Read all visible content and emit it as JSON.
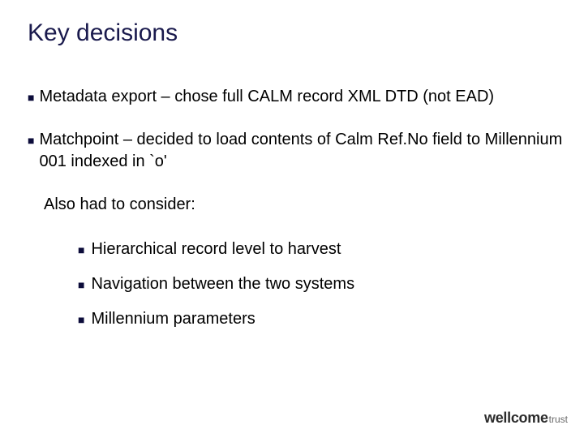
{
  "title": "Key decisions",
  "bullets": [
    "Metadata export – chose full CALM record XML DTD (not EAD)",
    "Matchpoint – decided to load contents of Calm Ref.No field to Millennium 001 indexed in `o'"
  ],
  "consider_label": "Also had to consider:",
  "subbullets": [
    "Hierarchical record level to harvest",
    "Navigation between the two systems",
    "Millennium parameters"
  ],
  "logo": {
    "main": "wellcome",
    "sub": "trust"
  }
}
